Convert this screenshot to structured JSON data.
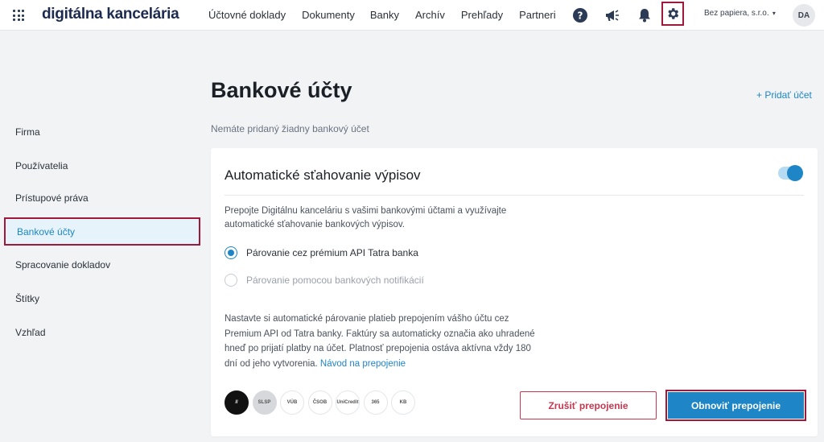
{
  "header": {
    "brand": "digitálna kancelária",
    "nav": [
      "Účtovné doklady",
      "Dokumenty",
      "Banky",
      "Archív",
      "Prehľady",
      "Partneri"
    ],
    "company": "Bez papiera, s.r.o.",
    "avatar_initials": "DA"
  },
  "sidebar": {
    "items": [
      "Firma",
      "Používatelia",
      "Prístupové práva",
      "Bankové účty",
      "Spracovanie dokladov",
      "Štítky",
      "Vzhľad"
    ],
    "active": "Bankové účty"
  },
  "main": {
    "title": "Bankové účty",
    "add_account": "+ Pridať účet",
    "empty_message": "Nemáte pridaný žiadny bankový účet"
  },
  "card": {
    "title": "Automatické sťahovanie výpisov",
    "toggle_on": true,
    "description": "Prepojte Digitálnu kanceláriu s vašimi bankovými účtami a využívajte automatické sťahovanie bankových výpisov.",
    "options": [
      {
        "label": "Párovanie cez prémium API Tatra banka",
        "selected": true
      },
      {
        "label": "Párovanie pomocou bankových notifikácií",
        "selected": false
      }
    ],
    "info_text": "Nastavte si automatické párovanie platieb prepojením vášho účtu cez Premium API od Tatra banky. Faktúry sa automaticky označia ako uhradené hneď po prijatí platby na účet. Platnosť prepojenia ostáva aktívna vždy 180 dní od jeho vytvorenia.",
    "info_link": "Návod na prepojenie",
    "bank_logos": [
      "//",
      "SLSP",
      "VÚB",
      "ČSOB",
      "UniCredit",
      "365",
      "KB"
    ],
    "cancel_label": "Zrušiť prepojenie",
    "renew_label": "Obnoviť prepojenie"
  },
  "colors": {
    "accent": "#1e86c6",
    "danger": "#c8384f",
    "highlight_border": "#a0183a",
    "active_bg": "#e6f3fb"
  }
}
